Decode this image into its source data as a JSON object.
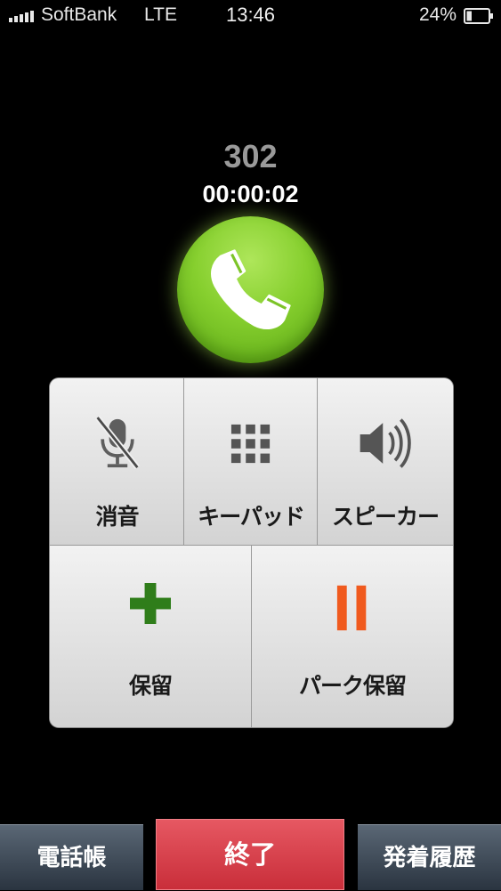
{
  "status_bar": {
    "carrier": "SoftBank",
    "network": "LTE",
    "time": "13:46",
    "battery": "24%",
    "battery_level": 0.24
  },
  "call": {
    "number": "302",
    "duration": "00:00:02",
    "badge_icon": "phone-handset-icon"
  },
  "controls": {
    "mute": {
      "label": "消音",
      "icon": "mic-off-icon"
    },
    "keypad": {
      "label": "キーパッド",
      "icon": "keypad-grid-icon"
    },
    "speaker": {
      "label": "スピーカー",
      "icon": "speaker-icon"
    },
    "hold": {
      "label": "保留",
      "icon": "plus-icon",
      "icon_color": "#2f7d1a"
    },
    "park_hold": {
      "label": "パーク保留",
      "icon": "pause-icon",
      "icon_color": "#f05a1e"
    }
  },
  "bottom_bar": {
    "contacts": "電話帳",
    "end": "終了",
    "history": "発着履歴",
    "end_color": "#d63a45"
  }
}
